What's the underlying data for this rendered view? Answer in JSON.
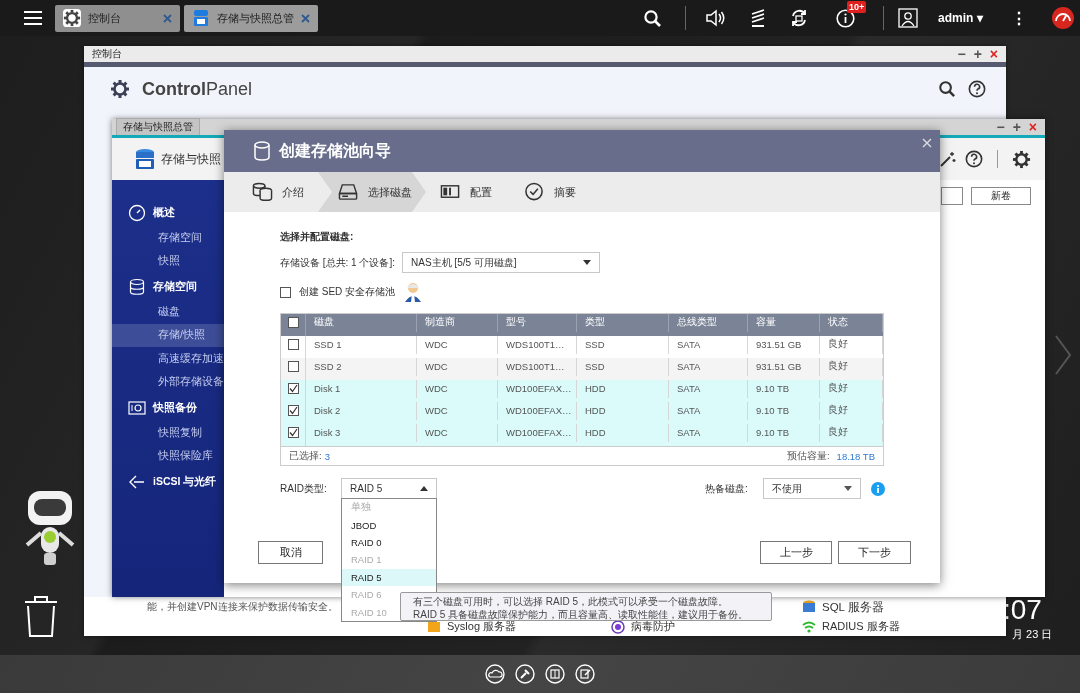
{
  "taskbar": {
    "tabs": [
      {
        "label": "控制台",
        "selected": false
      },
      {
        "label": "存储与快照总管",
        "selected": true
      }
    ],
    "badge": "10+",
    "user": "admin",
    "user_caret": "▾",
    "more": "⋮"
  },
  "control_panel": {
    "title": "控制台",
    "window_controls": [
      "−",
      "+",
      "×"
    ],
    "brand": "**Control**Panel",
    "description": "能，并创建VPN连接来保护数据传输安全。",
    "services": [
      "SQL 服务器",
      "Syslog 服务器",
      "病毒防护",
      "RADIUS 服务器"
    ]
  },
  "storage_window": {
    "title": "存储与快照总管",
    "window_controls": [
      "−",
      "+",
      "×"
    ],
    "header": "存储与快照",
    "new_volume_button": "新卷",
    "sidebar": [
      {
        "label": "概述",
        "selected": false,
        "children": [
          {
            "label": "存储空间",
            "selected": false
          },
          {
            "label": "快照",
            "selected": false
          }
        ]
      },
      {
        "label": "存储空间",
        "selected": false,
        "children": [
          {
            "label": "磁盘",
            "selected": false
          },
          {
            "label": "存储/快照",
            "selected": true
          },
          {
            "label": "高速缓存加速",
            "selected": false
          },
          {
            "label": "外部存储设备",
            "selected": false
          }
        ]
      },
      {
        "label": "快照备份",
        "selected": false,
        "children": [
          {
            "label": "快照复制",
            "selected": false
          },
          {
            "label": "快照保险库",
            "selected": false
          }
        ]
      },
      {
        "label": "iSCSI 与光纤",
        "selected": false
      }
    ]
  },
  "wizard": {
    "title": "创建存储池向导",
    "steps": [
      {
        "label": "介绍",
        "selected": false
      },
      {
        "label": "选择磁盘",
        "selected": true
      },
      {
        "label": "配置",
        "selected": false
      },
      {
        "label": "摘要",
        "selected": false
      }
    ],
    "section_label": "选择并配置磁盘:",
    "device_label": "存储设备 [总共: 1 个设备]:",
    "device_value": "NAS主机 [5/5 可用磁盘]",
    "sed": {
      "label": "创建 SED 安全存储池",
      "checked": false
    },
    "table": {
      "all_checked": false,
      "columns": [
        "磁盘",
        "制造商",
        "型号",
        "类型",
        "总线类型",
        "容量",
        "状态"
      ],
      "rows": [
        {
          "checked": false,
          "cells": [
            "SSD 1",
            "WDC",
            "WDS100T1…",
            "SSD",
            "SATA",
            "931.51 GB",
            "良好"
          ]
        },
        {
          "checked": false,
          "cells": [
            "SSD 2",
            "WDC",
            "WDS100T1…",
            "SSD",
            "SATA",
            "931.51 GB",
            "良好"
          ]
        },
        {
          "checked": true,
          "cells": [
            "Disk 1",
            "WDC",
            "WD100EFAX…",
            "HDD",
            "SATA",
            "9.10 TB",
            "良好"
          ]
        },
        {
          "checked": true,
          "cells": [
            "Disk 2",
            "WDC",
            "WD100EFAX…",
            "HDD",
            "SATA",
            "9.10 TB",
            "良好"
          ]
        },
        {
          "checked": true,
          "cells": [
            "Disk 3",
            "WDC",
            "WD100EFAX…",
            "HDD",
            "SATA",
            "9.10 TB",
            "良好"
          ]
        }
      ],
      "selected_label": "已选择:",
      "selected_count": "3",
      "capacity_label": "预估容量:",
      "capacity_value": "18.18 TB"
    },
    "raid": {
      "label": "RAID类型:",
      "value": "RAID 5",
      "expanded": true,
      "options": [
        {
          "label": "单独",
          "disabled": true,
          "selected": false
        },
        {
          "label": "JBOD",
          "disabled": false,
          "selected": false
        },
        {
          "label": "RAID 0",
          "disabled": false,
          "selected": false
        },
        {
          "label": "RAID 1",
          "disabled": true,
          "selected": false
        },
        {
          "label": "RAID 5",
          "disabled": false,
          "selected": true
        },
        {
          "label": "RAID 6",
          "disabled": true,
          "selected": false
        },
        {
          "label": "RAID 10",
          "disabled": true,
          "selected": false
        }
      ]
    },
    "spare": {
      "label": "热备磁盘:",
      "value": "不使用"
    },
    "buttons": {
      "cancel": "取消",
      "back": "上一步",
      "next": "下一步"
    }
  },
  "tooltip": [
    "有三个磁盘可用时，可以选择 RAID 5，此模式可以承受一个磁盘故障。",
    "RAID 5 具备磁盘故障保护能力，而且容量高、读取性能佳，建议用于备份。"
  ],
  "desktop": {
    "clock": ":07",
    "date": "月 23 日"
  }
}
